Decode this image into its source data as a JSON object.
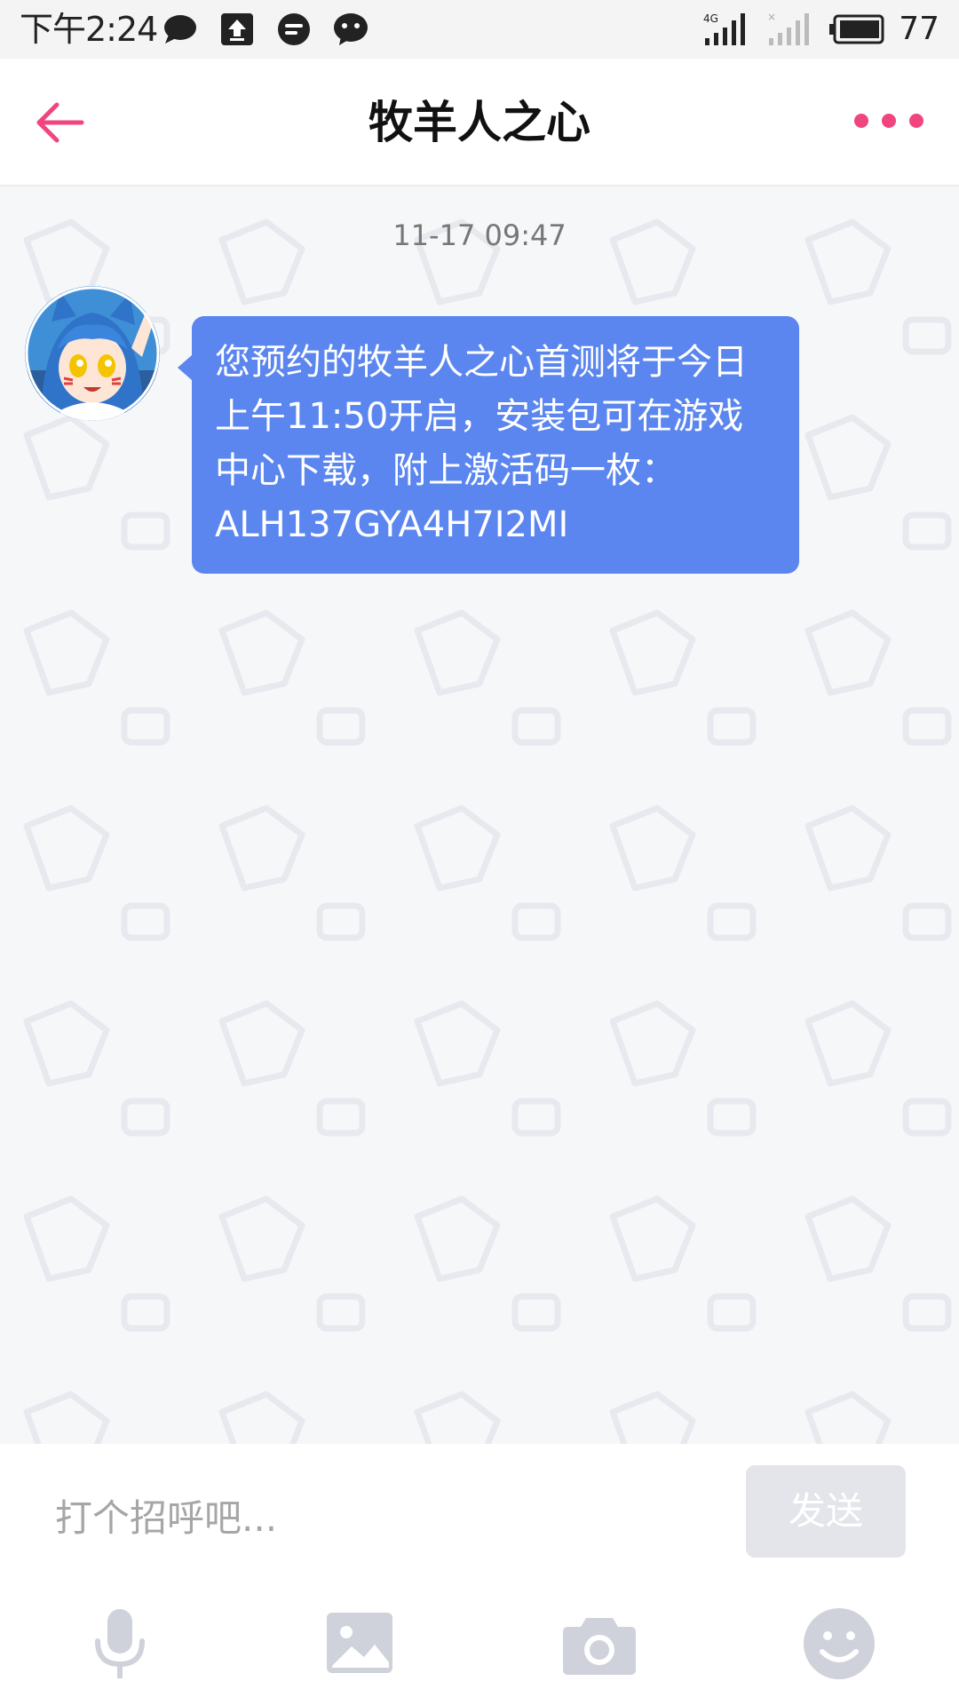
{
  "status_bar": {
    "time": "下午2:24",
    "network": "4G",
    "battery": "77"
  },
  "header": {
    "title": "牧羊人之心"
  },
  "chat": {
    "timestamp": "11-17 09:47",
    "message": "您预约的牧羊人之心首测将于今日上午11:50开启，安装包可在游戏中心下载，附上激活码一枚：ALH137GYA4H7I2MI"
  },
  "input": {
    "placeholder": "打个招呼吧...",
    "send_label": "发送"
  },
  "colors": {
    "accent": "#f0457f",
    "bubble": "#5b86ef",
    "toolbar_icon": "#cfd2da"
  }
}
